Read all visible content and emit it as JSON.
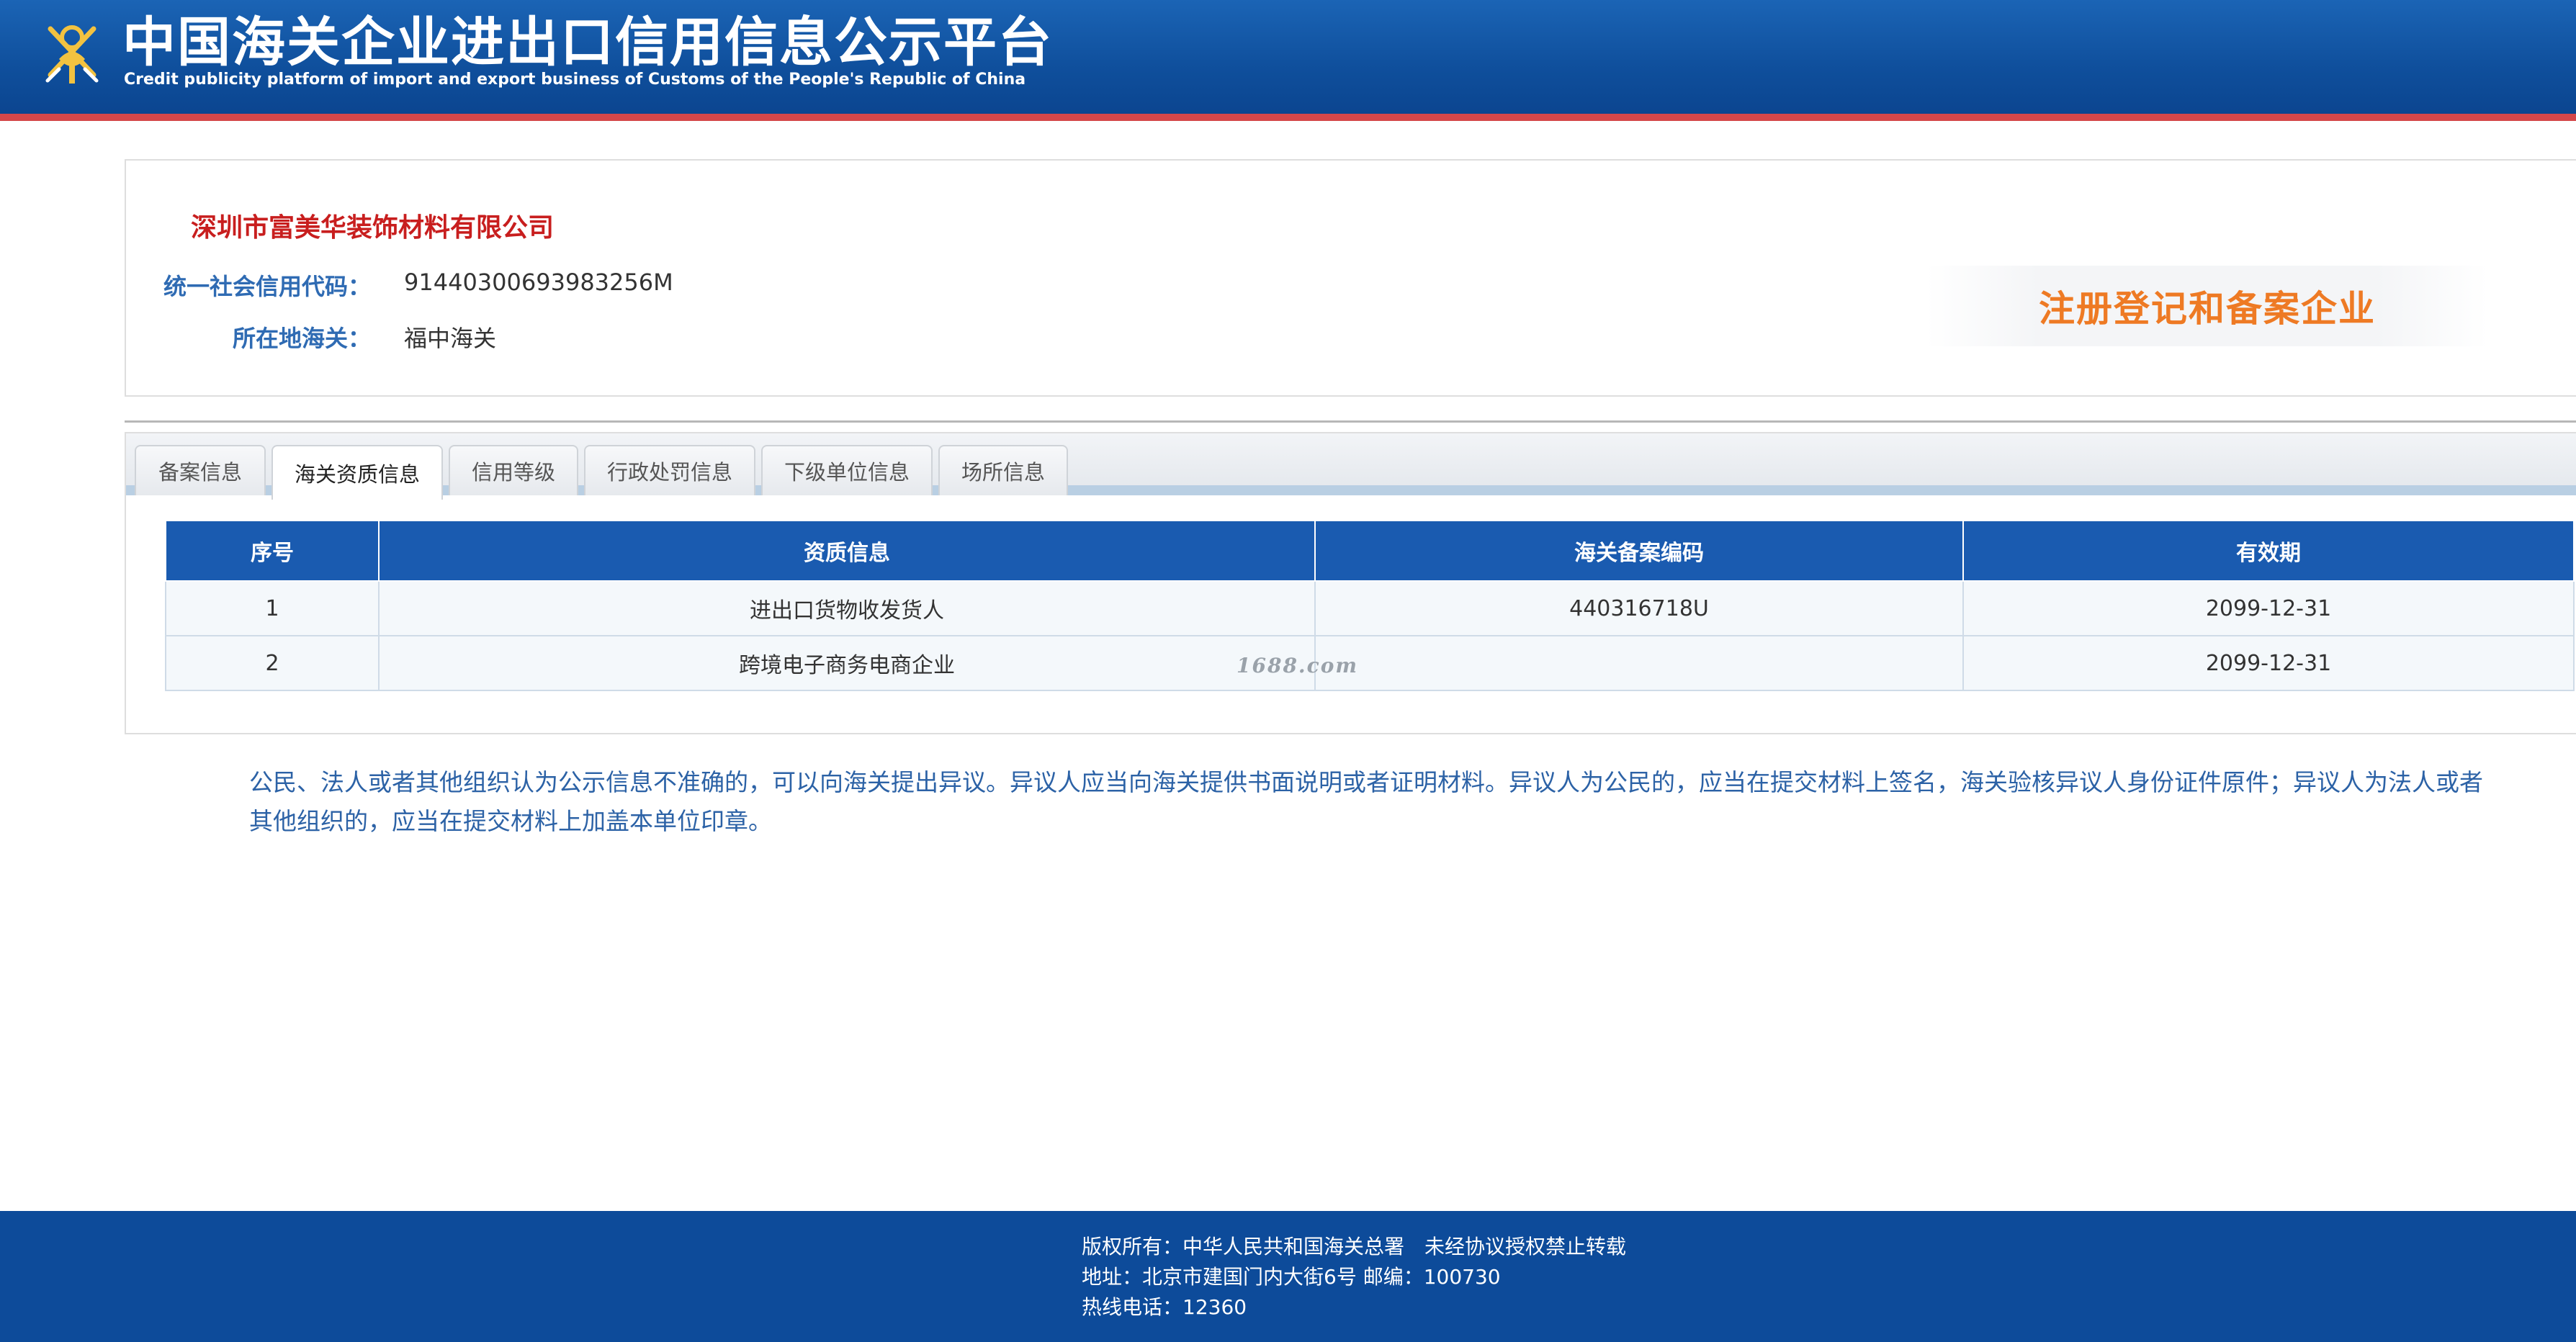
{
  "header": {
    "title": "中国海关企业进出口信用信息公示平台",
    "subtitle": "Credit publicity platform of import and export business of Customs of the People's Republic of China"
  },
  "company": {
    "name": "深圳市富美华装饰材料有限公司",
    "credit_code_label": "统一社会信用代码：",
    "credit_code": "91440300693983256M",
    "customs_label": "所在地海关：",
    "customs": "福中海关",
    "badge": "注册登记和备案企业"
  },
  "tabs": [
    {
      "label": "备案信息",
      "active": false
    },
    {
      "label": "海关资质信息",
      "active": true
    },
    {
      "label": "信用等级",
      "active": false
    },
    {
      "label": "行政处罚信息",
      "active": false
    },
    {
      "label": "下级单位信息",
      "active": false
    },
    {
      "label": "场所信息",
      "active": false
    }
  ],
  "table": {
    "headers": [
      "序号",
      "资质信息",
      "海关备案编码",
      "有效期"
    ],
    "rows": [
      [
        "1",
        "进出口货物收发货人",
        "440316718U",
        "2099-12-31"
      ],
      [
        "2",
        "跨境电子商务电商企业",
        "",
        "2099-12-31"
      ]
    ]
  },
  "watermark": "1688.com",
  "notice": "公民、法人或者其他组织认为公示信息不准确的，可以向海关提出异议。异议人应当向海关提供书面说明或者证明材料。异议人为公民的，应当在提交材料上签名，海关验核异议人身份证件原件；异议人为法人或者其他组织的，应当在提交材料上加盖本单位印章。",
  "footer": {
    "copyright": "版权所有：中华人民共和国海关总署　未经协议授权禁止转载",
    "address": "地址：北京市建国门内大街6号 邮编：100730",
    "hotline": "热线电话：12360"
  },
  "colors": {
    "header_blue": "#0f4f9c",
    "accent_red": "#d4474a",
    "company_red": "#c81e1e",
    "label_blue": "#2f6bb3",
    "table_header": "#1a5bb0",
    "badge_orange": "#ee7a24",
    "footer_blue": "#0d4b9a"
  },
  "icons": {
    "logo": "customs-emblem-icon"
  }
}
